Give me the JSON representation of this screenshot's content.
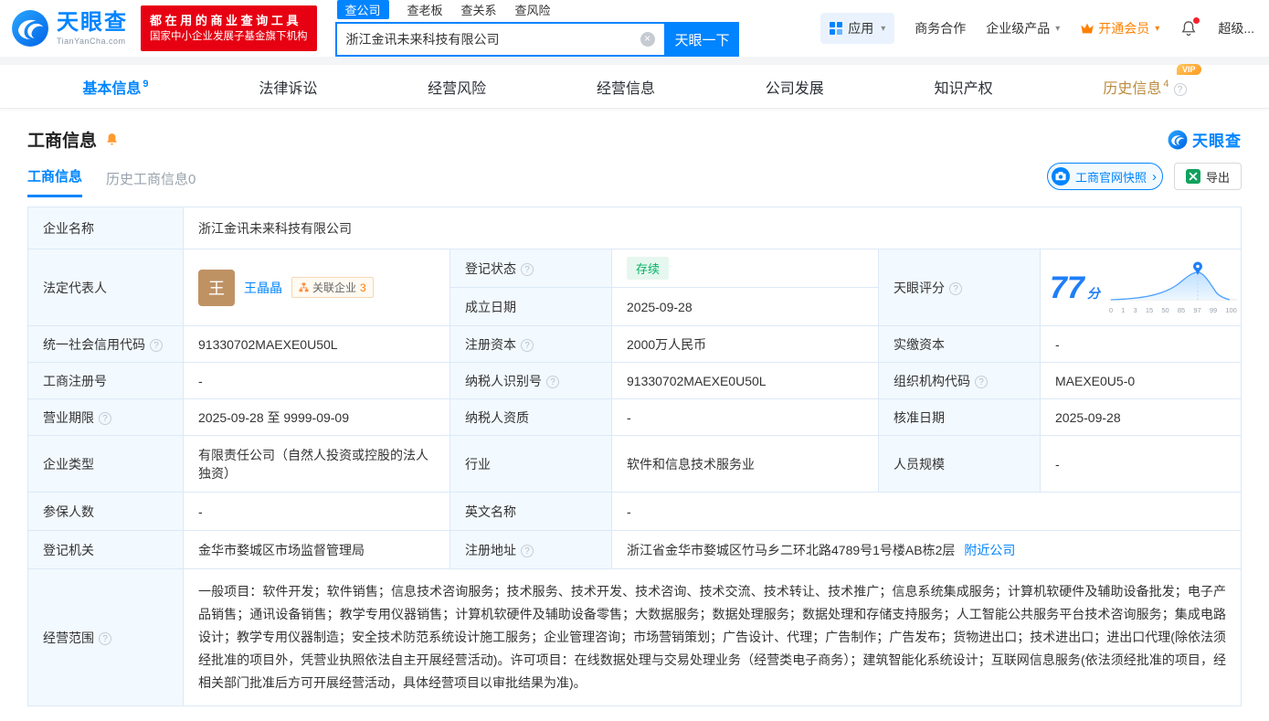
{
  "header": {
    "logo": {
      "title": "天眼查",
      "subtitle": "TianYanCha.com"
    },
    "slogan": {
      "line1": "都 在 用 的 商 业 查 询 工 具",
      "line2": "国家中小企业发展子基金旗下机构"
    },
    "search_tabs": [
      {
        "label": "查公司"
      },
      {
        "label": "查老板"
      },
      {
        "label": "查关系"
      },
      {
        "label": "查风险"
      }
    ],
    "search": {
      "value": "浙江金讯未来科技有限公司",
      "button": "天眼一下"
    },
    "menu": {
      "apps": "应用",
      "cooperation": "商务合作",
      "enterprise": "企业级产品",
      "vip": "开通会员",
      "user": "超级..."
    }
  },
  "nav": [
    {
      "label": "基本信息",
      "count": "9"
    },
    {
      "label": "法律诉讼"
    },
    {
      "label": "经营风险"
    },
    {
      "label": "经营信息"
    },
    {
      "label": "公司发展"
    },
    {
      "label": "知识产权"
    },
    {
      "label": "历史信息",
      "count": "4",
      "badge": "VIP"
    }
  ],
  "section": {
    "title": "工商信息",
    "brand": "天眼查"
  },
  "subtabs": [
    {
      "label": "工商信息"
    },
    {
      "label": "历史工商信息0"
    }
  ],
  "actions": {
    "snapshot": "工商官网快照",
    "export": "导出"
  },
  "info": {
    "company_name_label": "企业名称",
    "company_name": "浙江金讯未来科技有限公司",
    "legal_rep_label": "法定代表人",
    "legal_rep_avatar": "王",
    "legal_rep_name": "王晶晶",
    "related_label": "关联企业",
    "related_count": "3",
    "reg_status_label": "登记状态",
    "reg_status": "存续",
    "establish_date_label": "成立日期",
    "establish_date": "2025-09-28",
    "score_label": "天眼评分",
    "score": "77",
    "score_unit": "分",
    "score_axis": [
      "0",
      "1",
      "3",
      "15",
      "50",
      "85",
      "97",
      "99",
      "100"
    ],
    "credit_code_label": "统一社会信用代码",
    "credit_code": "91330702MAEXE0U50L",
    "reg_capital_label": "注册资本",
    "reg_capital": "2000万人民币",
    "paid_capital_label": "实缴资本",
    "paid_capital": "-",
    "reg_number_label": "工商注册号",
    "reg_number": "-",
    "taxpayer_id_label": "纳税人识别号",
    "taxpayer_id": "91330702MAEXE0U50L",
    "org_code_label": "组织机构代码",
    "org_code": "MAEXE0U5-0",
    "term_label": "营业期限",
    "term": "2025-09-28 至 9999-09-09",
    "taxpayer_quality_label": "纳税人资质",
    "taxpayer_quality": "-",
    "approval_date_label": "核准日期",
    "approval_date": "2025-09-28",
    "company_type_label": "企业类型",
    "company_type": "有限责任公司（自然人投资或控股的法人独资）",
    "industry_label": "行业",
    "industry": "软件和信息技术服务业",
    "staff_label": "人员规模",
    "staff": "-",
    "insured_label": "参保人数",
    "insured": "-",
    "english_label": "英文名称",
    "english": "-",
    "authority_label": "登记机关",
    "authority": "金华市婺城区市场监督管理局",
    "address_label": "注册地址",
    "address": "浙江省金华市婺城区竹马乡二环北路4789号1号楼AB栋2层",
    "nearby_link": "附近公司",
    "scope_label": "经营范围",
    "scope": "一般项目：软件开发；软件销售；信息技术咨询服务；技术服务、技术开发、技术咨询、技术交流、技术转让、技术推广；信息系统集成服务；计算机软硬件及辅助设备批发；电子产品销售；通讯设备销售；教学专用仪器销售；计算机软硬件及辅助设备零售；大数据服务；数据处理服务；数据处理和存储支持服务；人工智能公共服务平台技术咨询服务；集成电路设计；教学专用仪器制造；安全技术防范系统设计施工服务；企业管理咨询；市场营销策划；广告设计、代理；广告制作；广告发布；货物进出口；技术进出口；进出口代理(除依法须经批准的项目外，凭营业执照依法自主开展经营活动)。许可项目：在线数据处理与交易处理业务（经营类电子商务）；建筑智能化系统设计；互联网信息服务(依法须经批准的项目，经相关部门批准后方可开展经营活动，具体经营项目以审批结果为准)。"
  }
}
